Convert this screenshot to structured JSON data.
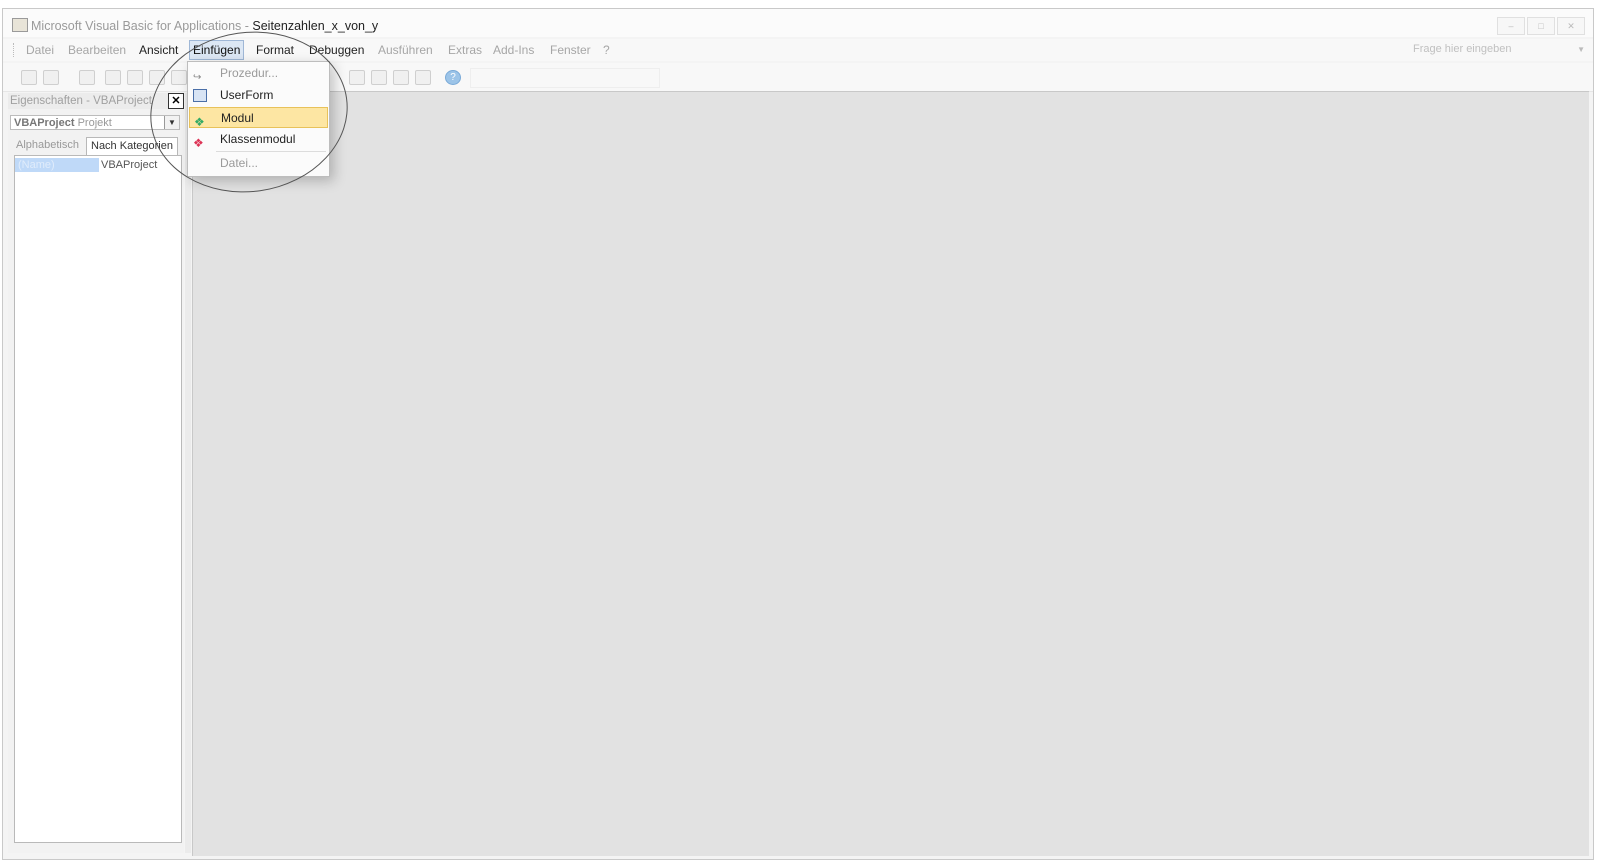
{
  "window": {
    "title_prefix": "Microsoft Visual Basic for Applications - ",
    "title_doc": "Seitenzahlen_x_von_y",
    "buttons": [
      "minimize-icon",
      "maximize-icon",
      "close-icon"
    ]
  },
  "menubar": {
    "items": [
      {
        "label": "Datei",
        "state": "disabled"
      },
      {
        "label": "Bearbeiten",
        "state": "disabled"
      },
      {
        "label": "Ansicht",
        "state": "enabled"
      },
      {
        "label": "Einfügen",
        "state": "open"
      },
      {
        "label": "Format",
        "state": "enabled"
      },
      {
        "label": "Debuggen",
        "state": "enabled"
      },
      {
        "label": "Ausführen",
        "state": "disabled"
      },
      {
        "label": "Extras",
        "state": "disabled"
      },
      {
        "label": "Add-Ins",
        "state": "disabled"
      },
      {
        "label": "Fenster",
        "state": "disabled"
      },
      {
        "label": "?",
        "state": "disabled"
      }
    ],
    "help_placeholder": "Frage hier eingeben"
  },
  "insert_menu": {
    "items": [
      {
        "label": "Prozedur...",
        "icon": "procedure-icon",
        "state": "disabled"
      },
      {
        "label": "UserForm",
        "icon": "userform-icon",
        "state": "enabled"
      },
      {
        "label": "Modul",
        "icon": "module-icon",
        "state": "highlighted"
      },
      {
        "label": "Klassenmodul",
        "icon": "class-module-icon",
        "state": "enabled"
      },
      {
        "label": "Datei...",
        "icon": "",
        "state": "disabled"
      }
    ]
  },
  "properties": {
    "header": "Eigenschaften - VBAProject",
    "object_name": "VBAProject",
    "object_type": "Projekt",
    "tabs": [
      "Alphabetisch",
      "Nach Kategorien"
    ],
    "rows": [
      {
        "key": "(Name)",
        "value": "VBAProject"
      }
    ]
  },
  "colors": {
    "menu_open_bg": "#dce7f4",
    "highlight": "#fde6a3",
    "workspace": "#e2e2e2",
    "selection": "#bfd9f8"
  }
}
